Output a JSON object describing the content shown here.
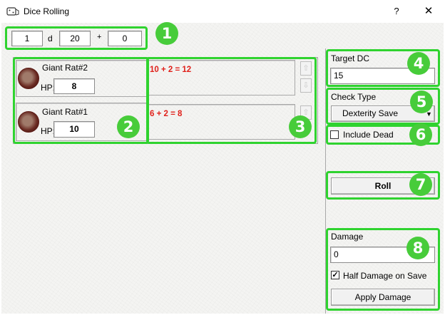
{
  "window": {
    "title": "Dice Rolling",
    "help_label": "?",
    "close_label": "✕",
    "icon": "dice-app-icon"
  },
  "dice": {
    "count": "1",
    "d_label": "d",
    "sides": "20",
    "plus_label": "+",
    "modifier": "0"
  },
  "targets": [
    {
      "name": "Giant Rat#2",
      "hp_label": "HP:",
      "hp": "8",
      "roll_result": "10 + 2 = 12"
    },
    {
      "name": "Giant Rat#1",
      "hp_label": "HP:",
      "hp": "10",
      "roll_result": "6 + 2 = 8"
    }
  ],
  "target_dc": {
    "label": "Target DC",
    "value": "15"
  },
  "check_type": {
    "label": "Check Type",
    "selected": "Dexterity Save"
  },
  "include_dead": {
    "label": "Include Dead",
    "checked": false
  },
  "roll_button": "Roll",
  "damage": {
    "label": "Damage",
    "value": "0"
  },
  "half_damage": {
    "label": "Half Damage on Save",
    "checked": true
  },
  "apply_damage_button": "Apply Damage",
  "annotations": [
    "1",
    "2",
    "3",
    "4",
    "5",
    "6",
    "7",
    "8"
  ],
  "colors": {
    "highlight": "#2fd32f",
    "badge": "#47cc3a",
    "roll_text": "#e0201a"
  }
}
